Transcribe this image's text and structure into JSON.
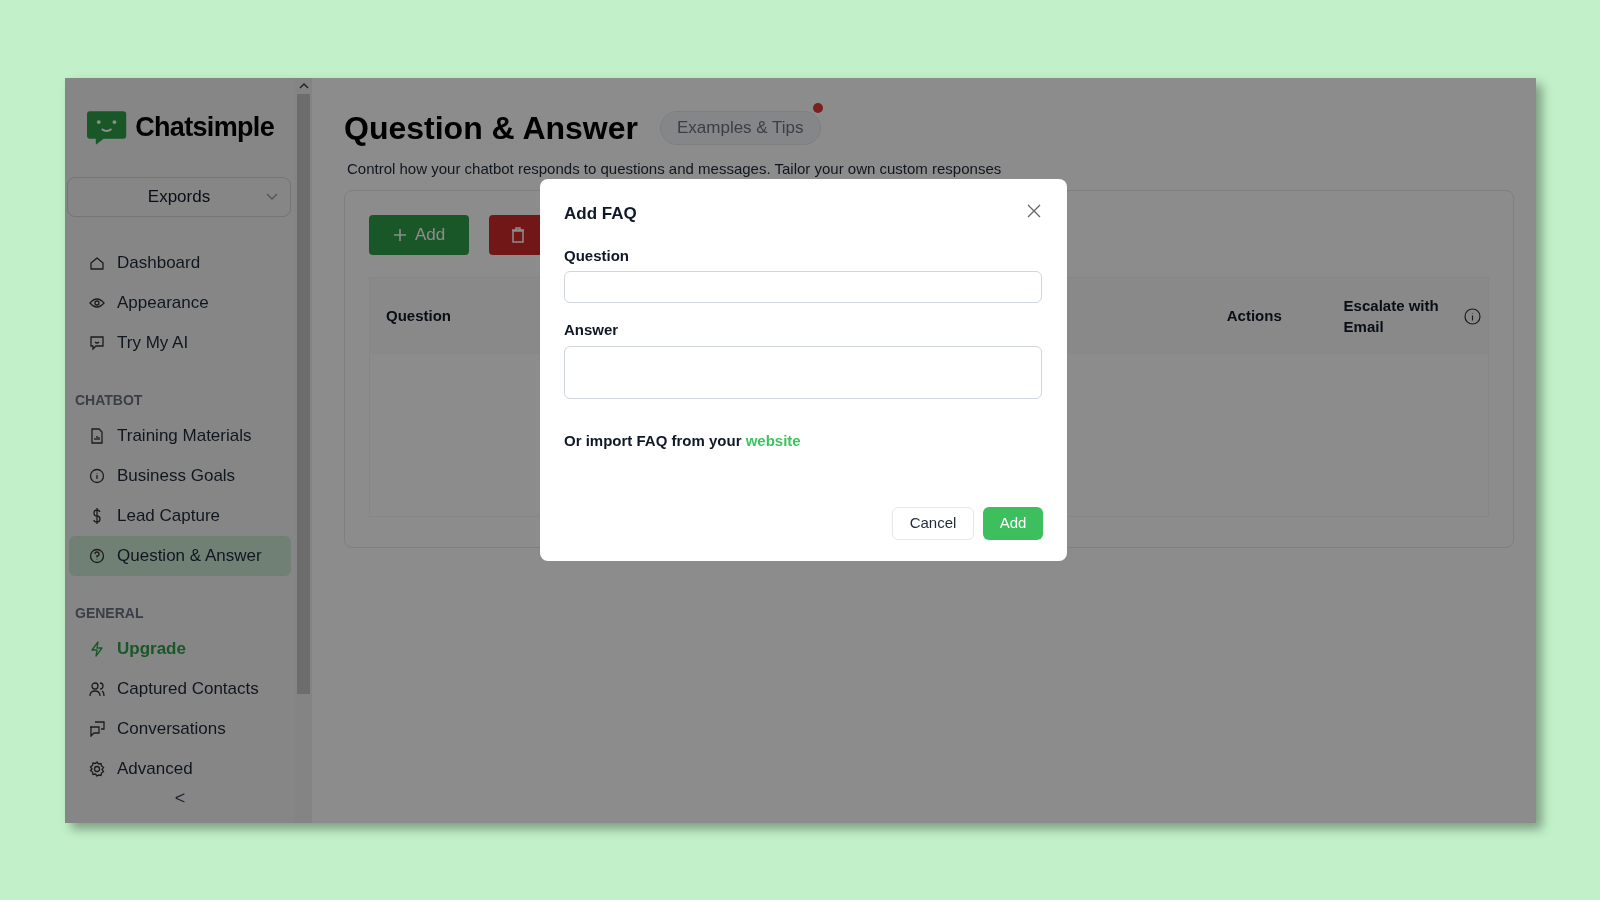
{
  "sidebar": {
    "brand": "Chatsimple",
    "workspace": "Expords",
    "groups": [
      {
        "items": [
          {
            "label": "Dashboard",
            "kind": "link",
            "selected": false
          },
          {
            "label": "Appearance",
            "kind": "link",
            "selected": false
          },
          {
            "label": "Try My AI",
            "kind": "link",
            "selected": false
          }
        ]
      },
      {
        "heading": "CHATBOT",
        "items": [
          {
            "label": "Training Materials",
            "kind": "link",
            "selected": false
          },
          {
            "label": "Business Goals",
            "kind": "link",
            "selected": false
          },
          {
            "label": "Lead Capture",
            "kind": "link",
            "selected": false
          },
          {
            "label": "Question & Answer",
            "kind": "link",
            "selected": true
          }
        ]
      },
      {
        "heading": "GENERAL",
        "items": [
          {
            "label": "Upgrade",
            "kind": "promo",
            "selected": false
          },
          {
            "label": "Captured Contacts",
            "kind": "link",
            "selected": false
          },
          {
            "label": "Conversations",
            "kind": "link",
            "selected": false
          },
          {
            "label": "Advanced",
            "kind": "link",
            "selected": false
          }
        ]
      }
    ],
    "collapse": "<"
  },
  "page": {
    "title": "Question & Answer",
    "tips_button": {
      "label": "Examples & Tips",
      "notification": true
    },
    "description": "Control how your chatbot responds to questions and messages. Tailor your own custom responses",
    "add_button": "Add",
    "table": {
      "columns": [
        {
          "label": "Question",
          "info": false
        },
        {
          "label": "Actions",
          "info": false
        },
        {
          "label": "Escalate with Email",
          "info": true
        }
      ]
    }
  },
  "modal": {
    "title": "Add FAQ",
    "fields": [
      {
        "label": "Question",
        "kind": "input"
      },
      {
        "label": "Answer",
        "kind": "textarea"
      }
    ],
    "import_text": "Or import FAQ from your",
    "import_link": "website",
    "buttons": [
      {
        "label": "Cancel",
        "kind": "secondary"
      },
      {
        "label": "Add",
        "kind": "primary"
      }
    ]
  }
}
